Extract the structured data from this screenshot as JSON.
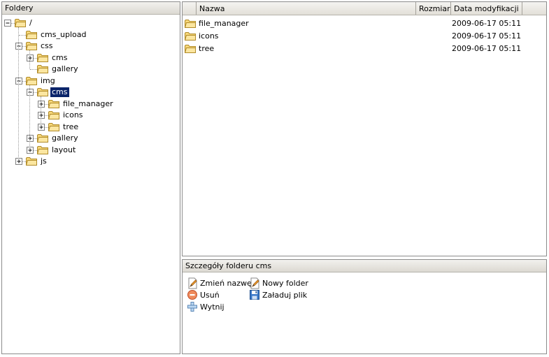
{
  "folders_panel": {
    "title": "Foldery"
  },
  "tree": [
    {
      "label": "/",
      "depth": 0,
      "toggle": "minus"
    },
    {
      "label": "cms_upload",
      "depth": 1,
      "toggle": "none"
    },
    {
      "label": "css",
      "depth": 1,
      "toggle": "minus"
    },
    {
      "label": "cms",
      "depth": 2,
      "toggle": "plus"
    },
    {
      "label": "gallery",
      "depth": 2,
      "toggle": "none"
    },
    {
      "label": "img",
      "depth": 1,
      "toggle": "minus"
    },
    {
      "label": "cms",
      "depth": 2,
      "toggle": "minus",
      "selected": true
    },
    {
      "label": "file_manager",
      "depth": 3,
      "toggle": "plus"
    },
    {
      "label": "icons",
      "depth": 3,
      "toggle": "plus"
    },
    {
      "label": "tree",
      "depth": 3,
      "toggle": "plus"
    },
    {
      "label": "gallery",
      "depth": 2,
      "toggle": "plus"
    },
    {
      "label": "layout",
      "depth": 2,
      "toggle": "plus"
    },
    {
      "label": "js",
      "depth": 1,
      "toggle": "plus"
    }
  ],
  "file_list": {
    "columns": {
      "name": "Nazwa",
      "size": "Rozmiar",
      "modified": "Data modyfikacji"
    },
    "rows": [
      {
        "name": "file_manager",
        "size": "",
        "modified": "2009-06-17 05:11"
      },
      {
        "name": "icons",
        "size": "",
        "modified": "2009-06-17 05:11"
      },
      {
        "name": "tree",
        "size": "",
        "modified": "2009-06-17 05:11"
      }
    ]
  },
  "details": {
    "title": "Szczegóły folderu cms",
    "actions": {
      "rename": "Zmień nazwę",
      "new_folder": "Nowy folder",
      "delete": "Usuń",
      "upload": "Załaduj plik",
      "cut": "Wytnij"
    }
  }
}
